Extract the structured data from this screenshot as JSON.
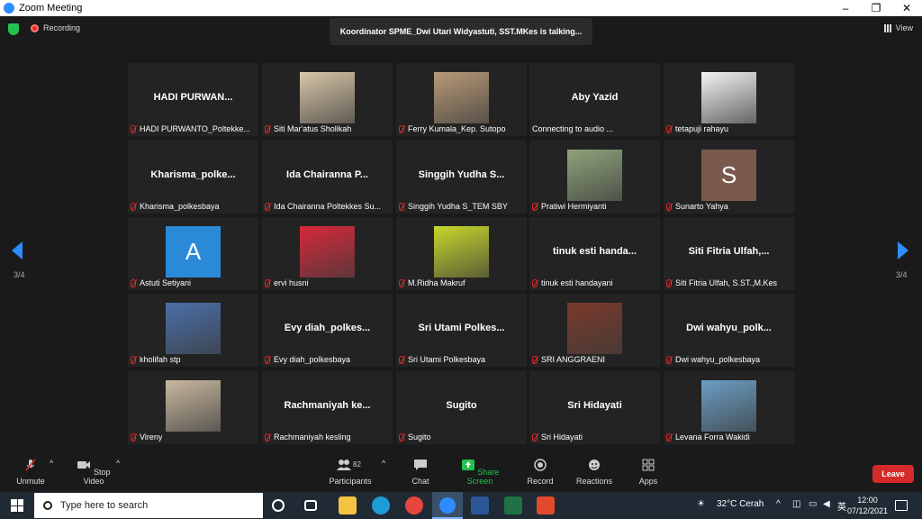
{
  "window": {
    "title": "Zoom Meeting",
    "minimize": "–",
    "restore": "❐",
    "close": "✕"
  },
  "topbar": {
    "recording_label": "Recording",
    "talking": "Koordinator SPME_Dwi Utari Widyastuti, SST.MKes is talking...",
    "view_label": "View"
  },
  "pager": {
    "left_page": "3/4",
    "right_page": "3/4"
  },
  "tiles": [
    {
      "big": "HADI  PURWAN...",
      "label": "HADI PURWANTO_Poltekke...",
      "muted": true
    },
    {
      "photo": "#d9c7a8",
      "label": "Siti Mar'atus Sholikah",
      "muted": true
    },
    {
      "photo": "#b89a77",
      "label": "Ferry Kumala_Kep. Sutopo",
      "muted": true
    },
    {
      "big": "Aby Yazid",
      "label": "Connecting to audio ...",
      "muted": false
    },
    {
      "photo": "#f4f4f4",
      "label": "tetapuji rahayu",
      "muted": true
    },
    {
      "big": "Kharisma_polke...",
      "label": "Kharisma_polkesbaya",
      "muted": true
    },
    {
      "big": "Ida  Chairanna  P...",
      "label": "Ida Chairanna Poltekkes Su...",
      "muted": true
    },
    {
      "big": "Singgih  Yudha  S...",
      "label": "Singgih Yudha S_TEM SBY",
      "muted": true
    },
    {
      "photo": "#8ea37a",
      "label": "Pratiwi Hermiyanti",
      "muted": true
    },
    {
      "letter": "S",
      "color": "#7a5a4d",
      "label": "Sunarto Yahya",
      "muted": true
    },
    {
      "letter": "A",
      "color": "#2b8ad8",
      "label": "Astuti Setiyani",
      "muted": true
    },
    {
      "photo": "#d8283a",
      "label": "ervi husni",
      "muted": true
    },
    {
      "photo": "#c7d82a",
      "label": "M.Ridha Makruf",
      "muted": true
    },
    {
      "big": "tinuk esti handa...",
      "label": "tinuk esti handayani",
      "muted": true
    },
    {
      "big": "Siti Fitria Ulfah,...",
      "label": "Siti Fitria Ulfah, S.ST.,M.Kes",
      "muted": true
    },
    {
      "photo": "#4a6fa8",
      "label": "kholifah stp",
      "muted": true
    },
    {
      "big": "Evy  diah_polkes...",
      "label": "Evy diah_polkesbaya",
      "muted": true
    },
    {
      "big": "Sri  Utami  Polkes...",
      "label": "Sri Utami Polkesbaya",
      "muted": true
    },
    {
      "photo": "#7a3a2a",
      "label": "SRI ANGGRAENI",
      "muted": true
    },
    {
      "big": "Dwi  wahyu_polk...",
      "label": "Dwi wahyu_polkesbaya",
      "muted": true
    },
    {
      "photo": "#c9b8a0",
      "label": "Vireny",
      "muted": true
    },
    {
      "big": "Rachmaniyah  ke...",
      "label": "Rachmaniyah kesling",
      "muted": true
    },
    {
      "big": "Sugito",
      "label": "Sugito",
      "muted": true
    },
    {
      "big": "Sri Hidayati",
      "label": "Sri Hidayati",
      "muted": true
    },
    {
      "photo": "#6a9ec4",
      "label": "Levana Forra Wakidi",
      "muted": true
    }
  ],
  "toolbar": {
    "unmute": "Unmute",
    "stop_video": "Stop Video",
    "participants": "Participants",
    "participant_count": "82",
    "chat": "Chat",
    "share_screen": "Share Screen",
    "record": "Record",
    "reactions": "Reactions",
    "apps": "Apps",
    "leave": "Leave",
    "share_color": "#23c24e",
    "leave_color": "#d52a2a"
  },
  "taskbar": {
    "search_placeholder": "Type here to search",
    "weather": "32°C  Cerah",
    "time": "12:00",
    "date": "07/12/2021"
  }
}
